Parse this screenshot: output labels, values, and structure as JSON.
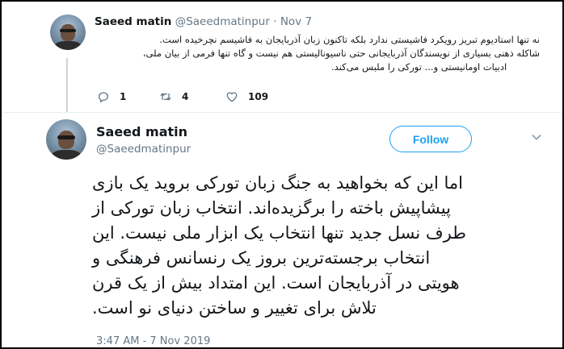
{
  "parent_tweet": {
    "author_name": "Saeed matin",
    "handle": "@Saeedmatinpur",
    "separator": "·",
    "date": "Nov 7",
    "lines": [
      "نه تنها استادیوم تبریز رویکرد فاشیستی ندارد بلکه تاکنون زبان آذربایجان به فاشیسم نچرخیده است.",
      "شاکله ذهنی بسیاری از نویسندگان آذربایجانی حتی ناسیونالیستی هم نیست و گاه تنها فرمی از بیان ملی،",
      "ادبیات اومانیستی و... تورکی را ملبس می‌کند."
    ],
    "actions": {
      "reply_count": "1",
      "retweet_count": "4",
      "like_count": "109"
    }
  },
  "main_tweet": {
    "author_name": "Saeed matin",
    "handle": "@Saeedmatinpur",
    "follow_label": "Follow",
    "lines": [
      "اما این که بخواهید به جنگ زبان تورکی بروید یک بازی",
      "پیشاپیش باخته را برگزیده‌اند. انتخاب زبان تورکی از",
      "طرف نسل جدید تنها انتخاب یک ابزار ملی نیست. این",
      "انتخاب برجسته‌ترین بروز یک رنسانس فرهنگی و",
      "هویتی در آذربایجان است. این امتداد بیش از یک قرن",
      "تلاش برای تغییر و ساختن دنیای نو است."
    ],
    "timestamp": "3:47 AM - 7 Nov 2019"
  },
  "colors": {
    "accent": "#1da1f2",
    "secondary_text": "#657786",
    "divider": "#e6ecf0"
  },
  "icons": [
    "reply-icon",
    "retweet-icon",
    "like-icon",
    "chevron-down-icon",
    "avatar"
  ]
}
